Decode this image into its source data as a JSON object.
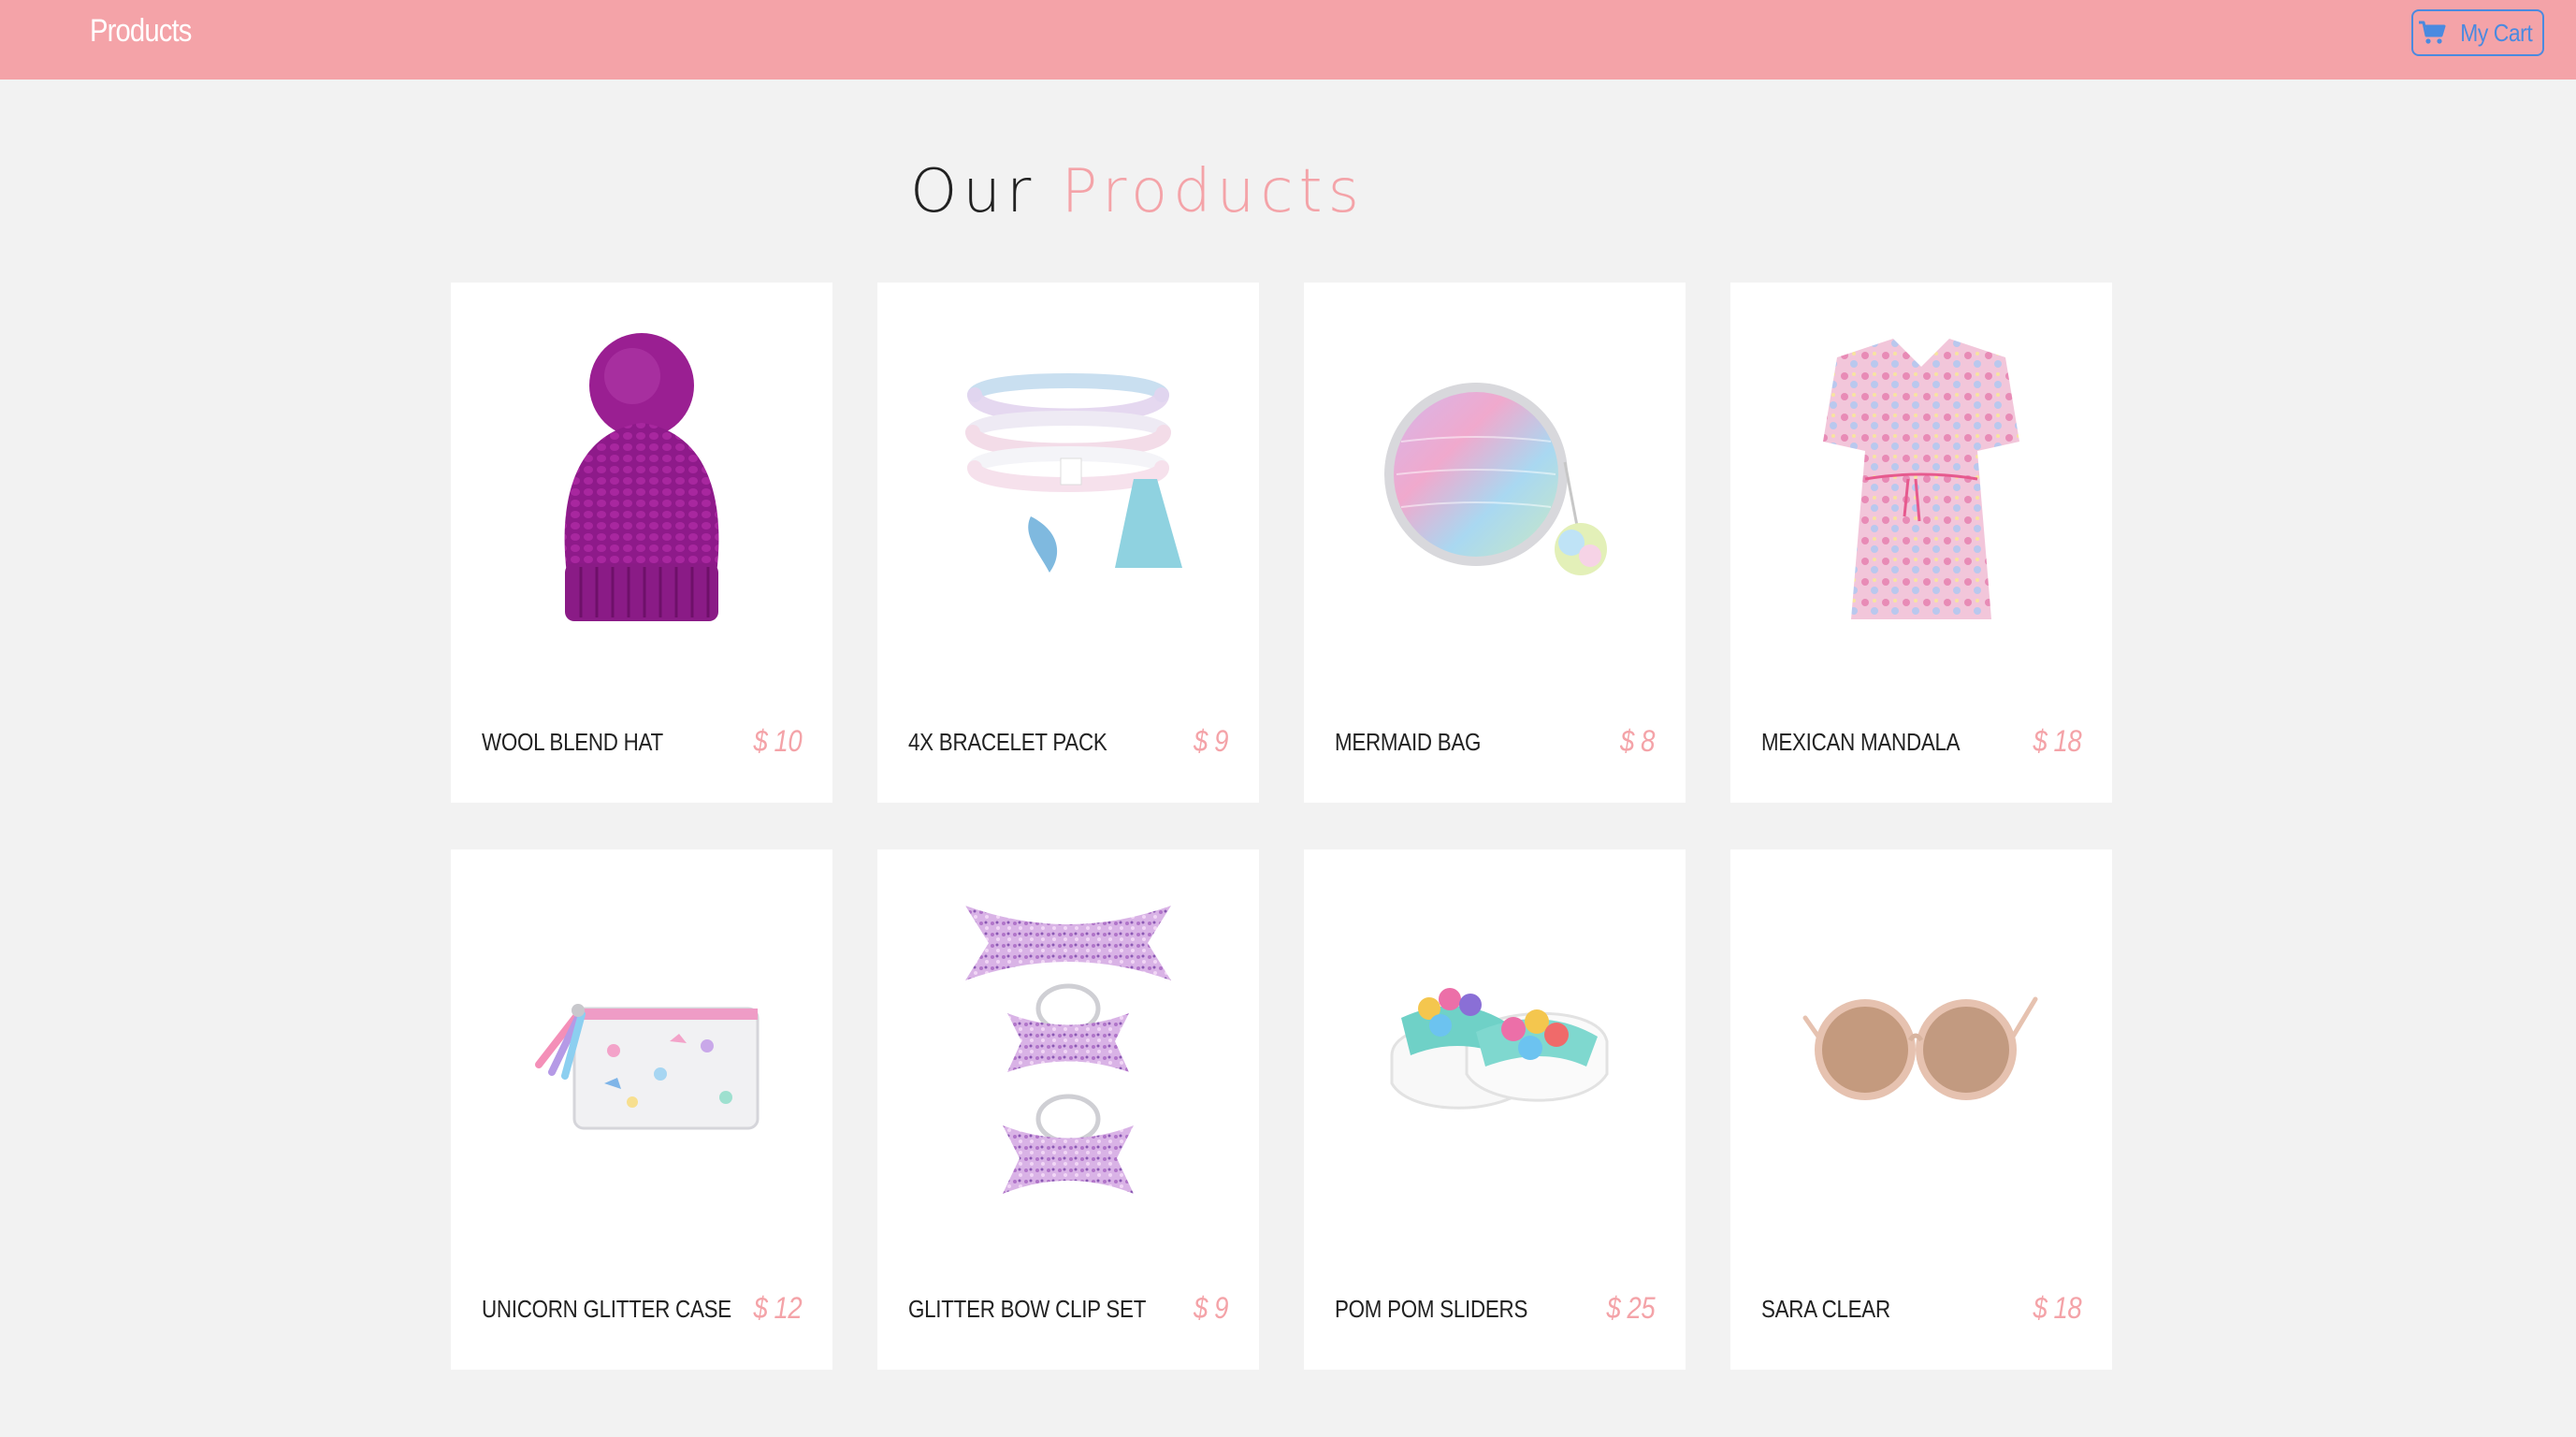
{
  "navbar": {
    "brand": "Products",
    "cart_label": "My Cart",
    "color": "#f4a3a8",
    "cart_color": "#4a8ae0"
  },
  "heading": {
    "first": "Our",
    "accent": "Products"
  },
  "products": [
    {
      "name": "WOOL BLEND HAT",
      "price": "$ 10",
      "image": "purple-pom-pom-beanie"
    },
    {
      "name": "4X BRACELET PACK",
      "price": "$ 9",
      "image": "beaded-bracelets-with-tassel"
    },
    {
      "name": "MERMAID BAG",
      "price": "$ 8",
      "image": "round-mermaid-scale-bag"
    },
    {
      "name": "MEXICAN MANDALA",
      "price": "$ 18",
      "image": "floral-kaftan-dress"
    },
    {
      "name": "UNICORN GLITTER CASE",
      "price": "$ 12",
      "image": "unicorn-pouch"
    },
    {
      "name": "GLITTER BOW CLIP SET",
      "price": "$ 9",
      "image": "glitter-bow-clips"
    },
    {
      "name": "POM POM SLIDERS",
      "price": "$ 25",
      "image": "pom-pom-slides"
    },
    {
      "name": "SARA CLEAR",
      "price": "$ 18",
      "image": "round-sunglasses"
    }
  ]
}
